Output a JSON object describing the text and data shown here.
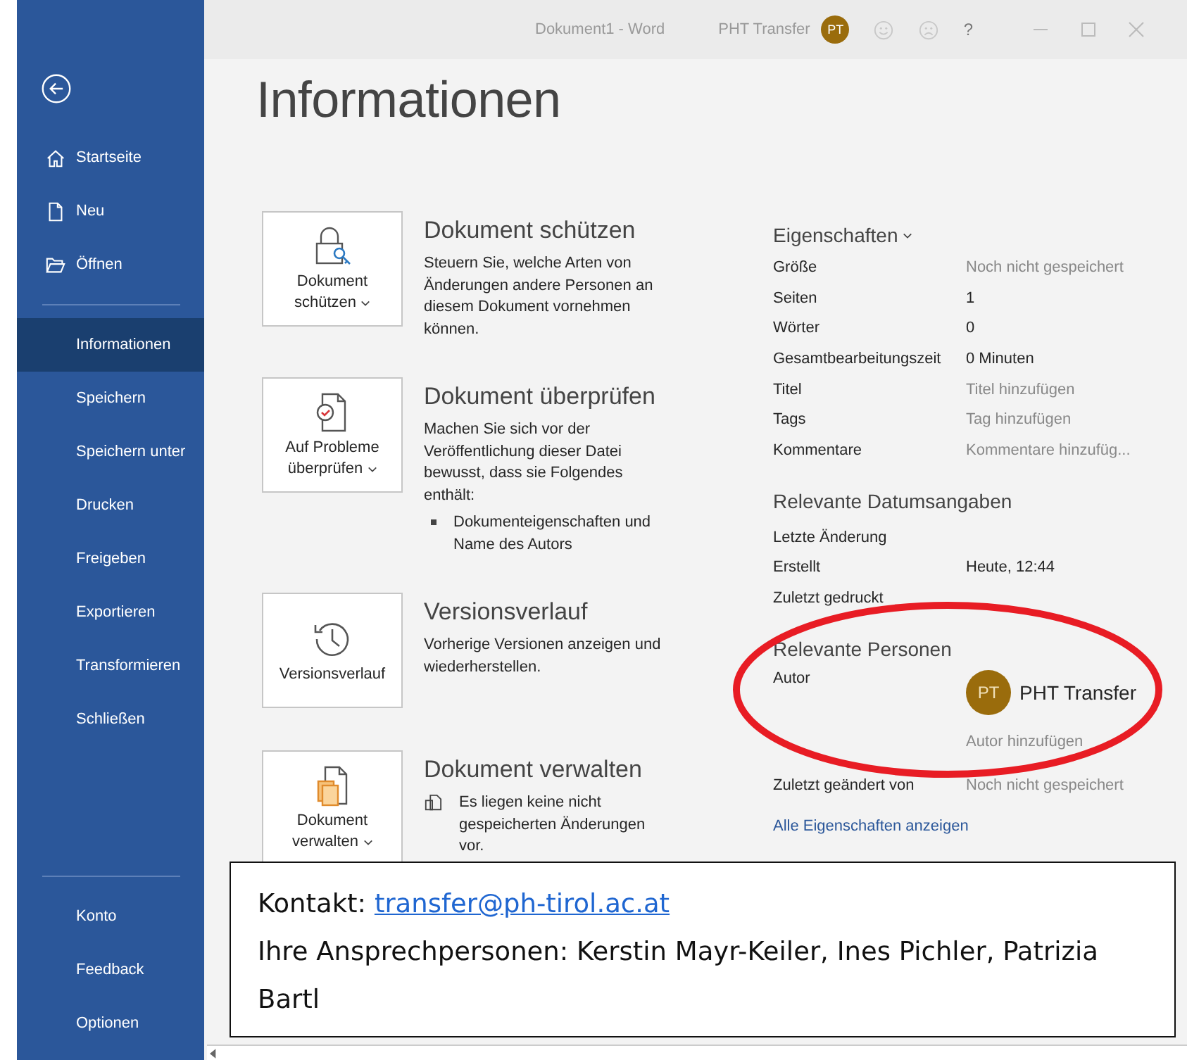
{
  "window": {
    "title": "Dokument1 - Word",
    "user": "PHT Transfer",
    "user_initials": "PT",
    "help": "?"
  },
  "sidebar": {
    "top_items": [
      {
        "label": "Startseite",
        "selected": false
      },
      {
        "label": "Neu",
        "selected": false
      },
      {
        "label": "Öffnen",
        "selected": false
      }
    ],
    "items": [
      {
        "label": "Informationen",
        "selected": true
      },
      {
        "label": "Speichern",
        "selected": false
      },
      {
        "label": "Speichern unter",
        "selected": false
      },
      {
        "label": "Drucken",
        "selected": false
      },
      {
        "label": "Freigeben",
        "selected": false
      },
      {
        "label": "Exportieren",
        "selected": false
      },
      {
        "label": "Transformieren",
        "selected": false
      },
      {
        "label": "Schließen",
        "selected": false
      }
    ],
    "bottom_items": [
      {
        "label": "Konto",
        "selected": false
      },
      {
        "label": "Feedback",
        "selected": false
      },
      {
        "label": "Optionen",
        "selected": false
      }
    ]
  },
  "page": {
    "title": "Informationen"
  },
  "sections": [
    {
      "kind": "protect",
      "button": [
        "Dokument",
        "schützen"
      ],
      "dropdown": true,
      "title": "Dokument schützen",
      "description": "Steuern Sie, welche Arten von Änderungen andere Personen an diesem Dokument vornehmen können."
    },
    {
      "kind": "inspect",
      "button": [
        "Auf Probleme",
        "überprüfen"
      ],
      "dropdown": true,
      "title": "Dokument überprüfen",
      "description": "Machen Sie sich vor der Veröffentlichung dieser Datei bewusst, dass sie Folgendes enthält:",
      "bullets": [
        "Dokumenteigenschaften und Name des Autors"
      ]
    },
    {
      "kind": "versions",
      "button": [
        "Versionsverlauf"
      ],
      "dropdown": false,
      "title": "Versionsverlauf",
      "description": "Vorherige Versionen anzeigen und wiederherstellen."
    },
    {
      "kind": "manage",
      "button": [
        "Dokument",
        "verwalten"
      ],
      "dropdown": true,
      "title": "Dokument verwalten",
      "note": "Es liegen keine nicht gespeicherten Änderungen vor."
    }
  ],
  "properties": {
    "heading": "Eigenschaften",
    "rows": [
      {
        "label": "Größe",
        "value": "Noch nicht gespeichert",
        "muted": true
      },
      {
        "label": "Seiten",
        "value": "1",
        "muted": false
      },
      {
        "label": "Wörter",
        "value": "0",
        "muted": false
      },
      {
        "label": "Gesamtbearbeitungszeit",
        "value": "0 Minuten",
        "muted": false
      },
      {
        "label": "Titel",
        "value": "Titel hinzufügen",
        "muted": true
      },
      {
        "label": "Tags",
        "value": "Tag hinzufügen",
        "muted": true
      },
      {
        "label": "Kommentare",
        "value": "Kommentare hinzufüg...",
        "muted": true
      }
    ]
  },
  "dates": {
    "heading": "Relevante Datumsangaben",
    "rows": [
      {
        "label": "Letzte Änderung"
      },
      {
        "label": "Erstellt",
        "value": "Heute, 12:44"
      },
      {
        "label": "Zuletzt gedruckt"
      }
    ]
  },
  "people": {
    "heading": "Relevante Personen",
    "author_label": "Autor",
    "author_initials": "PT",
    "author_name": "PHT Transfer",
    "add_author": "Autor hinzufügen",
    "modified_label": "Zuletzt geändert von",
    "modified_value": "Noch nicht gespeichert"
  },
  "all_properties_link": "Alle Eigenschaften anzeigen",
  "contact": {
    "label": "Kontakt:",
    "email": "transfer@ph-tirol.ac.at",
    "text": "Ihre Ansprechpersonen: Kerstin Mayr-Keiler, Ines Pichler, Patrizia Bartl"
  }
}
